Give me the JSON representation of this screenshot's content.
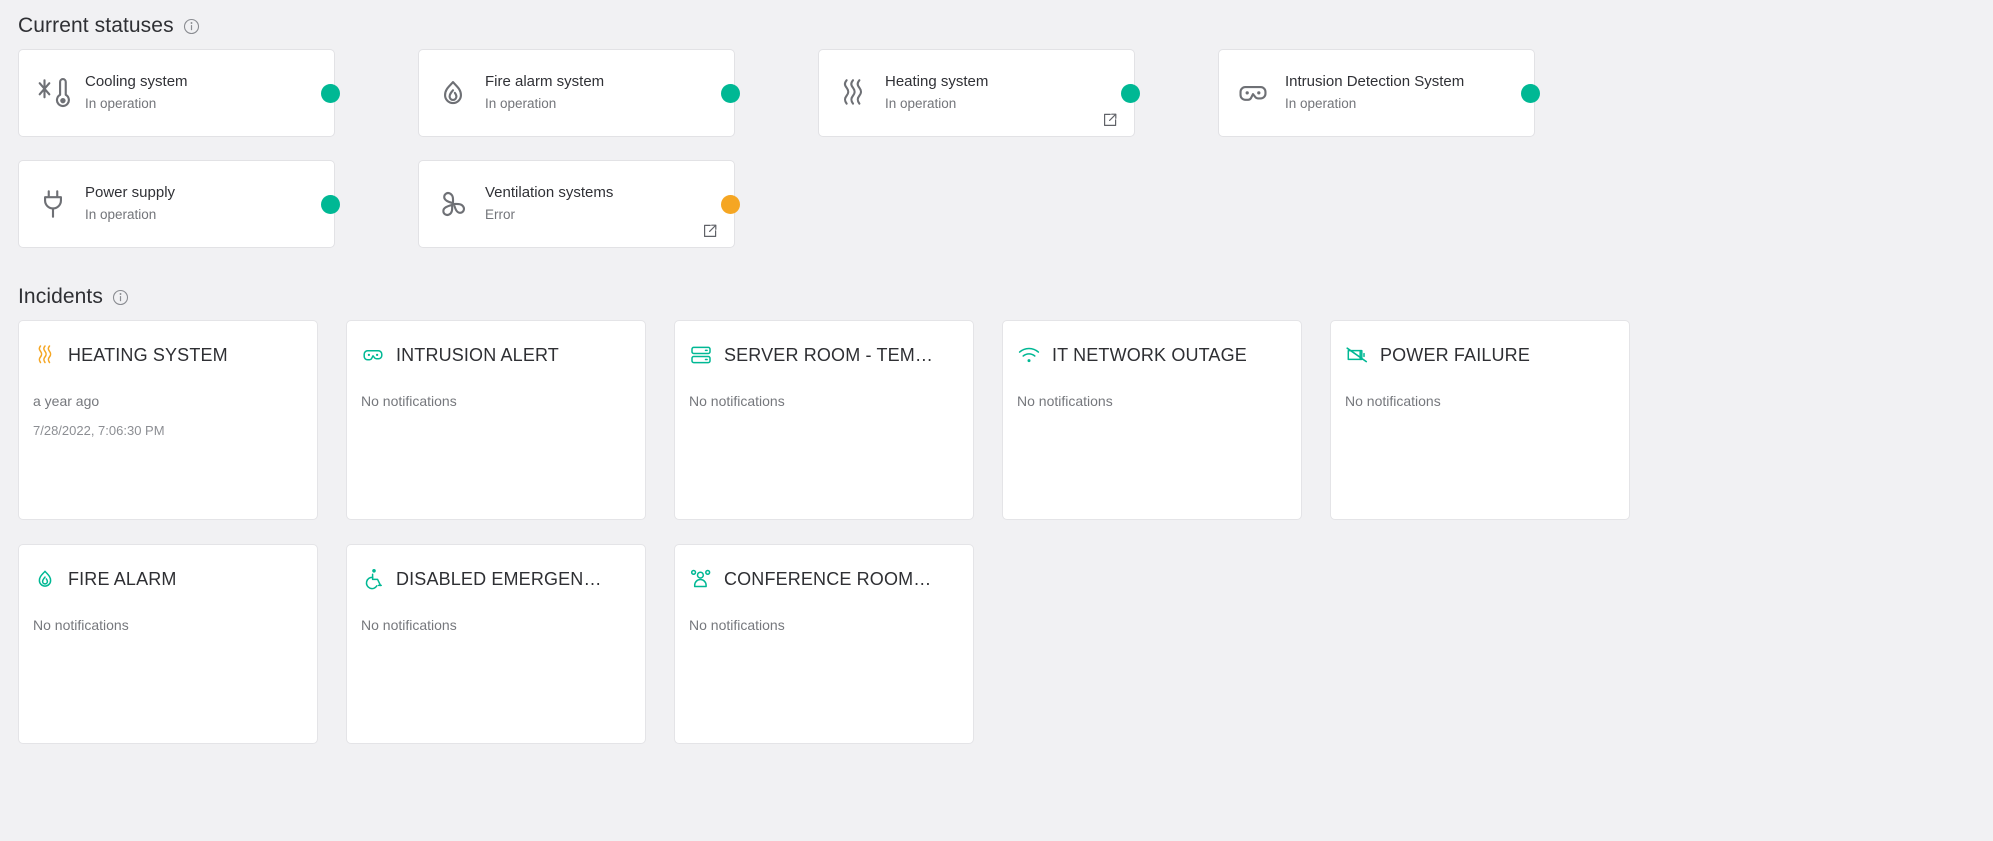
{
  "sections": {
    "statuses": {
      "title": "Current statuses",
      "info_icon": "info-icon"
    },
    "incidents": {
      "title": "Incidents",
      "info_icon": "info-icon"
    }
  },
  "colors": {
    "ok": "#00b894",
    "error": "#f5a623",
    "accent": "#00b894",
    "warn_icon": "#f5a623",
    "page_bg": "#f1f1f3",
    "card_bg": "#ffffff"
  },
  "statuses": [
    {
      "name": "Cooling system",
      "state": "In operation",
      "icon": "cooling-icon",
      "dot": "ok",
      "has_link": false
    },
    {
      "name": "Fire alarm system",
      "state": "In operation",
      "icon": "fire-icon",
      "dot": "ok",
      "has_link": false
    },
    {
      "name": "Heating system",
      "state": "In operation",
      "icon": "heating-icon",
      "dot": "ok",
      "has_link": true
    },
    {
      "name": "Intrusion Detection System",
      "state": "In operation",
      "icon": "intrusion-icon",
      "dot": "ok",
      "has_link": false
    },
    {
      "name": "Power supply",
      "state": "In operation",
      "icon": "plug-icon",
      "dot": "ok",
      "has_link": false
    },
    {
      "name": "Ventilation systems",
      "state": "Error",
      "icon": "fan-icon",
      "dot": "error",
      "has_link": true
    }
  ],
  "incidents": [
    {
      "title": "HEATING SYSTEM",
      "icon": "heating-icon",
      "icon_color": "#f5a623",
      "primary": "a year ago",
      "secondary": "7/28/2022, 7:06:30 PM"
    },
    {
      "title": "INTRUSION ALERT",
      "icon": "intrusion-icon",
      "icon_color": "#00b894",
      "primary": "No notifications",
      "secondary": ""
    },
    {
      "title": "SERVER ROOM - TEM…",
      "icon": "server-icon",
      "icon_color": "#00b894",
      "primary": "No notifications",
      "secondary": ""
    },
    {
      "title": "IT NETWORK OUTAGE",
      "icon": "wifi-icon",
      "icon_color": "#00b894",
      "primary": "No notifications",
      "secondary": ""
    },
    {
      "title": "POWER FAILURE",
      "icon": "battery-off-icon",
      "icon_color": "#00b894",
      "primary": "No notifications",
      "secondary": ""
    },
    {
      "title": "FIRE ALARM",
      "icon": "fire-icon",
      "icon_color": "#00b894",
      "primary": "No notifications",
      "secondary": ""
    },
    {
      "title": "DISABLED EMERGEN…",
      "icon": "wheelchair-icon",
      "icon_color": "#00b894",
      "primary": "No notifications",
      "secondary": ""
    },
    {
      "title": "CONFERENCE ROOM…",
      "icon": "people-icon",
      "icon_color": "#00b894",
      "primary": "No notifications",
      "secondary": ""
    }
  ]
}
